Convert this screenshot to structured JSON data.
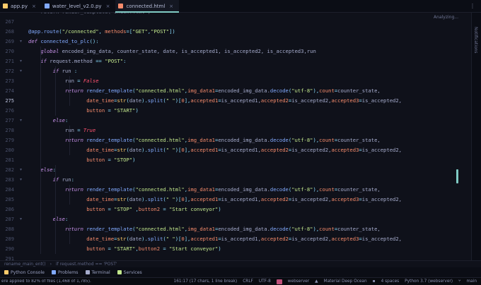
{
  "tabs": [
    {
      "label": "app.py",
      "icon_color": "#ffcb6b",
      "active": false
    },
    {
      "label": "water_level_v2.0.py",
      "icon_color": "#82aaff",
      "active": false
    },
    {
      "label": "connected.html",
      "icon_color": "#f78c6c",
      "active": true
    }
  ],
  "tabbar": {
    "more": "⋮"
  },
  "editor": {
    "analyzing": "Analyzing...",
    "top_partial": "    return render_template('index.html')",
    "current_line": 275,
    "lines": [
      {
        "n": 267,
        "html": ""
      },
      {
        "n": 268,
        "html": "<span class='t-dec'>@app.route</span><span class='t-punc'>(</span><span class='t-str'>\"/connected\"</span><span class='t-punc'>, </span><span class='t-par'>methods</span><span class='t-op'>=</span><span class='t-punc'>[</span><span class='t-str'>\"GET\"</span><span class='t-punc'>,</span><span class='t-str'>\"POST\"</span><span class='t-punc'>])</span>"
      },
      {
        "n": 269,
        "html": "<span class='t-kw'>def </span><span class='t-fn'>connected_to_plc</span><span class='t-punc'>():</span>"
      },
      {
        "n": 270,
        "html": "    <span class='t-kw'>global </span>encoded_img_data, counter_state, date, is_accepted1, is_accepted2, is_accepted3,run"
      },
      {
        "n": 271,
        "html": "    <span class='t-kw'>if </span>request.method <span class='t-op'>==</span> <span class='t-str'>\"POST\"</span><span class='t-punc'>:</span>"
      },
      {
        "n": 272,
        "html": "        <span class='t-kw'>if </span>run <span class='t-punc'>:</span>"
      },
      {
        "n": 273,
        "html": "            run <span class='t-op'>=</span> <span class='t-const'>False</span>"
      },
      {
        "n": 274,
        "html": "            <span class='t-kw'>return </span><span class='t-fn'>render_template</span><span class='t-punc'>(</span><span class='t-str'>\"connected.html\"</span><span class='t-punc'>,</span><span class='t-par'>img_data1</span><span class='t-op'>=</span>encoded_img_data.<span class='t-fn'>decode</span><span class='t-punc'>(</span><span class='t-str'>\"utf-8\"</span><span class='t-punc'>),</span><span class='t-par'>count</span><span class='t-op'>=</span>counter_state,"
      },
      {
        "n": 275,
        "html": "                   <span class='t-par'>date_time</span><span class='t-op'>=</span><span class='t-bi'>str</span><span class='t-punc'>(</span>date<span class='t-punc'>).</span><span class='t-fn'>split</span><span class='t-punc'>(</span><span class='t-str'>\" \"</span><span class='t-punc'>)[</span><span class='t-par'>0</span><span class='t-punc'>],</span><span class='t-par'>accepted1</span><span class='t-op'>=</span>is_accepted1,<span class='t-par'>accepted2</span><span class='t-op'>=</span>is_accepted2,<span class='t-par'>accepted3</span><span class='t-op'>=</span>is_accepted2,"
      },
      {
        "n": 276,
        "html": "                   <span class='t-par'>button</span> <span class='t-op'>=</span> <span class='t-str'>\"START\"</span><span class='t-punc'>)</span>"
      },
      {
        "n": 277,
        "html": "        <span class='t-kw'>else</span><span class='t-punc'>:</span>"
      },
      {
        "n": 278,
        "html": "            run <span class='t-op'>=</span> <span class='t-const'>True</span>"
      },
      {
        "n": 279,
        "html": "            <span class='t-kw'>return </span><span class='t-fn'>render_template</span><span class='t-punc'>(</span><span class='t-str'>\"connected.html\"</span><span class='t-punc'>,</span><span class='t-par'>img_data1</span><span class='t-op'>=</span>encoded_img_data.<span class='t-fn'>decode</span><span class='t-punc'>(</span><span class='t-str'>\"utf-8\"</span><span class='t-punc'>),</span><span class='t-par'>count</span><span class='t-op'>=</span>counter_state,"
      },
      {
        "n": 280,
        "html": "                   <span class='t-par'>date_time</span><span class='t-op'>=</span><span class='t-bi'>str</span><span class='t-punc'>(</span>date<span class='t-punc'>).</span><span class='t-fn'>split</span><span class='t-punc'>(</span><span class='t-str'>\" \"</span><span class='t-punc'>)[</span><span class='t-par'>0</span><span class='t-punc'>],</span><span class='t-par'>accepted1</span><span class='t-op'>=</span>is_accepted1,<span class='t-par'>accepted2</span><span class='t-op'>=</span>is_accepted2,<span class='t-par'>accepted3</span><span class='t-op'>=</span>is_accepted2,"
      },
      {
        "n": 281,
        "html": "                   <span class='t-par'>button</span> <span class='t-op'>=</span> <span class='t-str'>\"STOP\"</span><span class='t-punc'>)</span>"
      },
      {
        "n": 282,
        "html": "    <span class='t-kw'>else</span><span class='t-punc'>:</span>"
      },
      {
        "n": 283,
        "html": "        <span class='t-kw'>if </span>run<span class='t-punc'>:</span>"
      },
      {
        "n": 284,
        "html": "            <span class='t-kw'>return </span><span class='t-fn'>render_template</span><span class='t-punc'>(</span><span class='t-str'>\"connected.html\"</span><span class='t-punc'>,</span><span class='t-par'>img_data1</span><span class='t-op'>=</span>encoded_img_data.<span class='t-fn'>decode</span><span class='t-punc'>(</span><span class='t-str'>\"utf-8\"</span><span class='t-punc'>),</span><span class='t-par'>count</span><span class='t-op'>=</span>counter_state,"
      },
      {
        "n": 285,
        "html": "                   <span class='t-par'>date_time</span><span class='t-op'>=</span><span class='t-bi'>str</span><span class='t-punc'>(</span>date<span class='t-punc'>).</span><span class='t-fn'>split</span><span class='t-punc'>(</span><span class='t-str'>\" \"</span><span class='t-punc'>)[</span><span class='t-par'>0</span><span class='t-punc'>],</span><span class='t-par'>accepted1</span><span class='t-op'>=</span>is_accepted1,<span class='t-par'>accepted2</span><span class='t-op'>=</span>is_accepted2,<span class='t-par'>accepted3</span><span class='t-op'>=</span>is_accepted2,"
      },
      {
        "n": 286,
        "html": "                   <span class='t-par'>button</span> <span class='t-op'>=</span> <span class='t-str'>\"STOP\"</span> <span class='t-punc'>,</span><span class='t-par'>button2</span> <span class='t-op'>=</span> <span class='t-str'>\"Start conveyor\"</span><span class='t-punc'>)</span>"
      },
      {
        "n": 287,
        "html": "        <span class='t-kw'>else</span><span class='t-punc'>:</span>"
      },
      {
        "n": 288,
        "html": "            <span class='t-kw'>return </span><span class='t-fn'>render_template</span><span class='t-punc'>(</span><span class='t-str'>\"connected.html\"</span><span class='t-punc'>,</span><span class='t-par'>img_data1</span><span class='t-op'>=</span>encoded_img_data.<span class='t-fn'>decode</span><span class='t-punc'>(</span><span class='t-str'>\"utf-8\"</span><span class='t-punc'>),</span><span class='t-par'>count</span><span class='t-op'>=</span>counter_state,"
      },
      {
        "n": 289,
        "html": "                   <span class='t-par'>date_time</span><span class='t-op'>=</span><span class='t-bi'>str</span><span class='t-punc'>(</span>date<span class='t-punc'>).</span><span class='t-fn'>split</span><span class='t-punc'>(</span><span class='t-str'>\" \"</span><span class='t-punc'>)[</span><span class='t-par'>0</span><span class='t-punc'>],</span><span class='t-par'>accepted1</span><span class='t-op'>=</span>is_accepted1,<span class='t-par'>accepted2</span><span class='t-op'>=</span>is_accepted2,<span class='t-par'>accepted3</span><span class='t-op'>=</span>is_accepted2,"
      },
      {
        "n": 290,
        "html": "                   <span class='t-par'>button</span> <span class='t-op'>=</span> <span class='t-str'>\"START\"</span><span class='t-punc'>,</span><span class='t-par'>button2</span> <span class='t-op'>=</span> <span class='t-str'>\"Start conveyor\"</span><span class='t-punc'>)</span>"
      },
      {
        "n": 291,
        "html": ""
      }
    ]
  },
  "rightstrip": {
    "label": "Notifications"
  },
  "breadcrumb": {
    "items": [
      "rename_main_ent()",
      "if request.method == 'POST'"
    ]
  },
  "toolwindows": [
    {
      "label": "Python Console",
      "color": "#ffcb6b"
    },
    {
      "label": "Problems",
      "color": "#82aaff"
    },
    {
      "label": "Terminal",
      "color": "#a6accd"
    },
    {
      "label": "Services",
      "color": "#c3e88d"
    }
  ],
  "statusbar": {
    "left": "ere applied to 82% of files (1,468 of 1,785).",
    "position": "161:17 (17 chars, 1 line break)",
    "line_sep": "CRLF",
    "encoding": "UTF-8",
    "project": "webserver",
    "theme": "Material Deep Ocean",
    "indent": "4 spaces",
    "interpreter": "Python 3.7 (webserver)",
    "branch": "main"
  }
}
